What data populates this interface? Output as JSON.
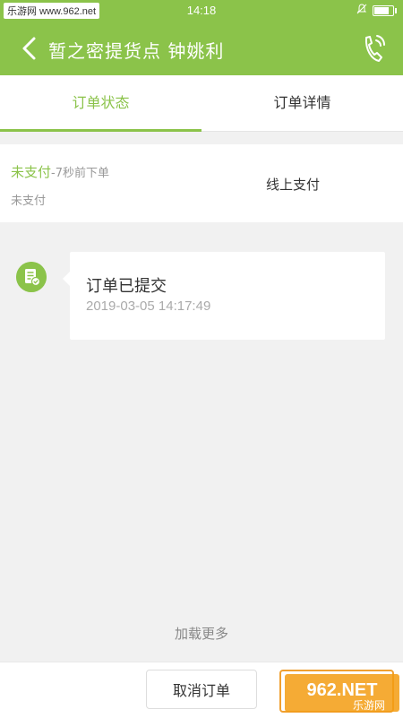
{
  "status_bar": {
    "site_label": "乐游网 www.962.net",
    "time": "14:18"
  },
  "header": {
    "title": "暂之密提货点 钟姚利"
  },
  "tabs": [
    {
      "label": "订单状态",
      "active": true
    },
    {
      "label": "订单详情",
      "active": false
    }
  ],
  "summary": {
    "status": "未支付",
    "ago": "-7秒前下单",
    "status_sub": "未支付",
    "payment_method": "线上支付"
  },
  "timeline": [
    {
      "title": "订单已提交",
      "time": "2019-03-05 14:17:49"
    }
  ],
  "load_more": "加载更多",
  "bottom": {
    "cancel_label": "取消订单"
  },
  "watermark": {
    "text": "962.NET 乐游网"
  },
  "colors": {
    "accent": "#8bc34a",
    "muted": "#999999"
  }
}
